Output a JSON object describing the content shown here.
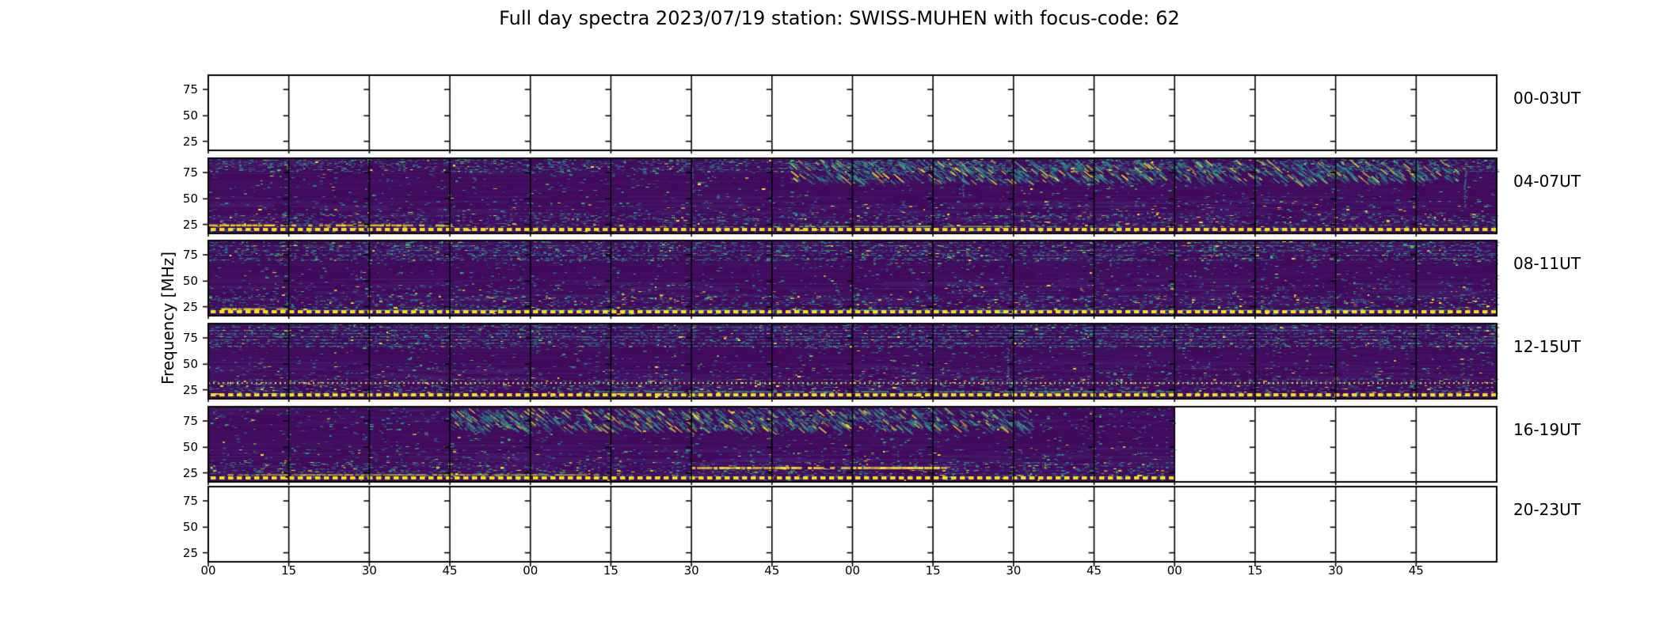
{
  "figure": {
    "title": "Full day spectra 2023/07/19 station: SWISS-MUHEN with focus-code: 62"
  },
  "y_axis": {
    "label": "Frequency [MHz]",
    "tick_labels": [
      "75",
      "50",
      "25"
    ]
  },
  "x_axis": {
    "tick_labels": [
      "00",
      "15",
      "30",
      "45",
      "00",
      "15",
      "30",
      "45",
      "00",
      "15",
      "30",
      "45",
      "00",
      "15",
      "30",
      "45"
    ]
  },
  "rows": [
    {
      "label": "00-03UT",
      "coverage": "empty",
      "segments": 16,
      "filled_segments": 0
    },
    {
      "label": "04-07UT",
      "coverage": "full",
      "segments": 16,
      "filled_segments": 16
    },
    {
      "label": "08-11UT",
      "coverage": "full",
      "segments": 16,
      "filled_segments": 16
    },
    {
      "label": "12-15UT",
      "coverage": "full",
      "segments": 16,
      "filled_segments": 16
    },
    {
      "label": "16-19UT",
      "coverage": "partial",
      "segments": 16,
      "filled_segments": 12
    },
    {
      "label": "20-23UT",
      "coverage": "empty",
      "segments": 16,
      "filled_segments": 0
    }
  ],
  "colors": {
    "background": "#ffffff",
    "axes_border": "#000000",
    "spectrogram_base": "#410a5c",
    "speckle_teal": "#2a788e",
    "speckle_green": "#35b779",
    "speckle_yellow": "#fde725",
    "marker_line_yellow": "#f3e11d"
  },
  "chart_data": {
    "type": "heatmap",
    "subtype": "radio-spectrogram-grid",
    "title": "Full day spectra 2023/07/19 station: SWISS-MUHEN with focus-code: 62",
    "station": "SWISS-MUHEN",
    "date": "2023/07/19",
    "focus_code": "62",
    "ylabel": "Frequency [MHz]",
    "y_ticks_mhz": [
      75,
      50,
      25
    ],
    "y_range_mhz_approx": [
      16,
      88
    ],
    "x_tick_labels": [
      "00",
      "15",
      "30",
      "45",
      "00",
      "15",
      "30",
      "45",
      "00",
      "15",
      "30",
      "45",
      "00",
      "15",
      "30",
      "45"
    ],
    "x_units": "minutes past each hour, 4 hours per row",
    "segments_per_row": 16,
    "segment_minutes": 15,
    "colormap": "viridis",
    "grid": "off",
    "legend_position": "none",
    "rows": [
      {
        "time_range": "00-03UT",
        "data_present": false,
        "filled_segments": 0,
        "note": "blank white panels"
      },
      {
        "time_range": "04-07UT",
        "data_present": true,
        "filled_segments": 16,
        "note": "dark viridis spectra; yellow dashed marker line along panel bottom; bright yellow band near 25 MHz in first segments"
      },
      {
        "time_range": "08-11UT",
        "data_present": true,
        "filled_segments": 16,
        "note": "dark viridis spectra; wavy teal activity near 75-85 MHz; yellow dashed marker line along panel bottom"
      },
      {
        "time_range": "12-15UT",
        "data_present": true,
        "filled_segments": 16,
        "note": "strong horizontal teal striping near 70-85 MHz; fine yellow dotted line near 25 MHz; yellow dashed marker line along panel bottom"
      },
      {
        "time_range": "16-19UT",
        "data_present": true,
        "filled_segments": 12,
        "note": "data only 16:00-19:00 (12 of 16 segments); diagonal teal pattern at top; bright yellow band near 25 MHz mid-row; yellow dashed marker line along panel bottom"
      },
      {
        "time_range": "20-23UT",
        "data_present": false,
        "filled_segments": 0,
        "note": "blank white panels"
      }
    ]
  }
}
